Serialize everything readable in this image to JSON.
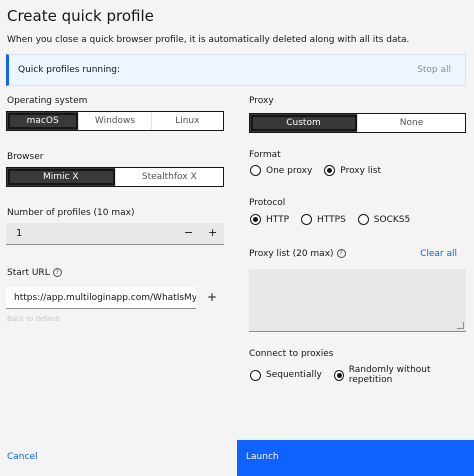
{
  "dialog": {
    "title": "Create quick profile",
    "subtitle": "When you close a quick browser profile, it is automatically deleted along with all its data."
  },
  "banner": {
    "text": "Quick profiles running:",
    "stop_label": "Stop all"
  },
  "os": {
    "label": "Operating system",
    "options": [
      "macOS",
      "Windows",
      "Linux"
    ],
    "selected": "macOS"
  },
  "browser": {
    "label": "Browser",
    "options": [
      "Mimic X",
      "Stealthfox X"
    ],
    "selected": "Mimic X"
  },
  "profiles": {
    "label": "Number of profiles (10 max)",
    "value": "1",
    "decrement": "−",
    "increment": "+"
  },
  "start_url": {
    "label": "Start URL",
    "help_icon": "?",
    "value": "https://app.multiloginapp.com/WhatIsMyIF",
    "add": "+",
    "back_to_default": "Back to default"
  },
  "proxy": {
    "label": "Proxy",
    "options": [
      "Custom",
      "None"
    ],
    "selected": "Custom"
  },
  "format": {
    "label": "Format",
    "options": [
      "One proxy",
      "Proxy list"
    ],
    "selected": "Proxy list"
  },
  "protocol": {
    "label": "Protocol",
    "options": [
      "HTTP",
      "HTTPS",
      "SOCKS5"
    ],
    "selected": "HTTP"
  },
  "proxy_list": {
    "label": "Proxy list (20 max)",
    "help_icon": "?",
    "clear_label": "Clear all"
  },
  "connect": {
    "label": "Connect to proxies",
    "options": [
      "Sequentially",
      "Randomly without repetition"
    ],
    "selected": "Randomly without repetition"
  },
  "footer": {
    "cancel_label": "Cancel",
    "launch_label": "Launch"
  },
  "colors": {
    "accent": "#0f62fe",
    "selected_segment": "#393939"
  }
}
